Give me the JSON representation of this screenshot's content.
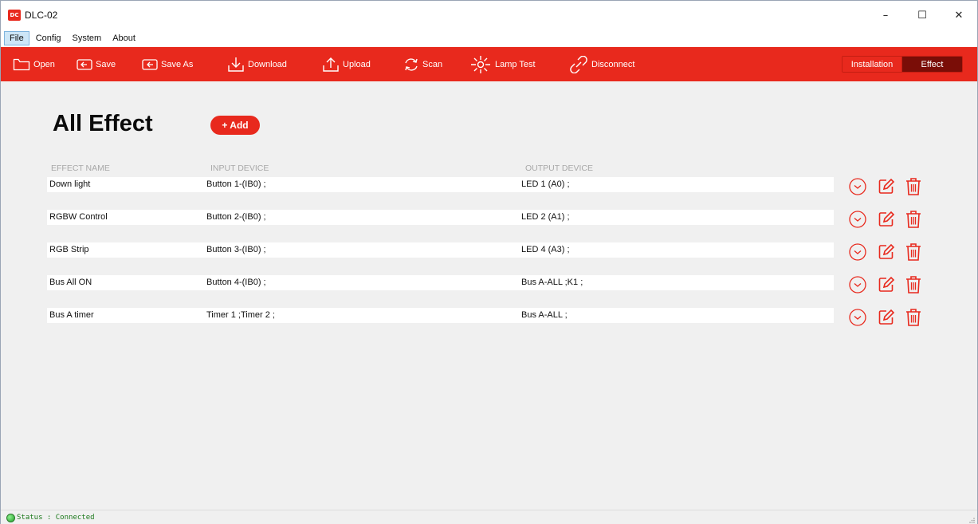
{
  "window": {
    "title": "DLC-02",
    "app_icon_text": "DC",
    "minimize": "–",
    "maximize": "☐",
    "close": "✕"
  },
  "menu": [
    "File",
    "Config",
    "System",
    "About"
  ],
  "toolbar": {
    "open": "Open",
    "save": "Save",
    "save_as": "Save As",
    "download": "Download",
    "upload": "Upload",
    "scan": "Scan",
    "lamp_test": "Lamp Test",
    "disconnect": "Disconnect",
    "mode_installation": "Installation",
    "mode_effect": "Effect",
    "active_mode": "Effect"
  },
  "page": {
    "title": "All Effect",
    "add_button": "+ Add"
  },
  "table": {
    "headers": [
      "EFFECT NAME",
      "INPUT DEVICE",
      "OUTPUT DEVICE"
    ],
    "rows": [
      {
        "name": "Down light",
        "input": "Button 1-(IB0) ;",
        "output": "LED 1 (A0) ;"
      },
      {
        "name": "RGBW Control",
        "input": "Button 2-(IB0) ;",
        "output": "LED 2 (A1) ;"
      },
      {
        "name": "RGB Strip",
        "input": "Button 3-(IB0) ;",
        "output": "LED 4 (A3) ;"
      },
      {
        "name": "Bus All ON",
        "input": "Button 4-(IB0) ;",
        "output": "Bus A-ALL ;K1 ;"
      },
      {
        "name": "Bus A timer",
        "input": "Timer 1 ;Timer 2 ;",
        "output": "Bus A-ALL ;"
      }
    ]
  },
  "status": {
    "text": "Status : Connected"
  },
  "colors": {
    "accent": "#e8291d",
    "active_toggle": "#7a0d07",
    "status_green": "#1d7a1d"
  }
}
